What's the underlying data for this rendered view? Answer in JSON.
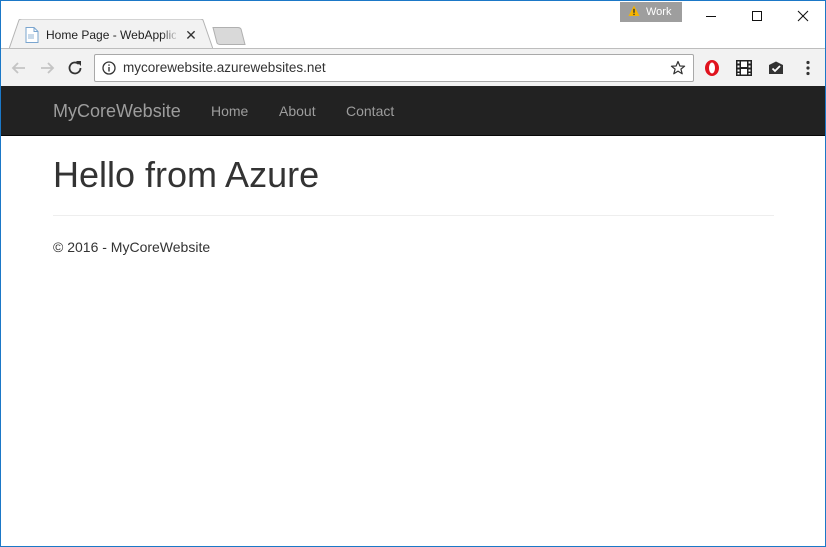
{
  "browser": {
    "tab": {
      "title": "Home Page - WebApplication",
      "close_glyph": "✕"
    },
    "profile": {
      "label": "Work"
    },
    "address_bar": {
      "url": "mycorewebsite.azurewebsites.net"
    },
    "icons": {
      "back": "back-arrow-icon",
      "forward": "forward-arrow-icon",
      "reload": "reload-icon",
      "info": "info-icon",
      "bookmark": "star-icon",
      "opera": "opera-icon",
      "film": "film-icon",
      "mail": "mail-check-icon",
      "menu": "kebab-menu-icon"
    },
    "colors": {
      "frame_border": "#1b78c7",
      "opera_red": "#e0131e"
    }
  },
  "site": {
    "navbar": {
      "brand": "MyCoreWebsite",
      "links": [
        "Home",
        "About",
        "Contact"
      ]
    },
    "heading": "Hello from Azure",
    "footer": "© 2016 - MyCoreWebsite"
  }
}
